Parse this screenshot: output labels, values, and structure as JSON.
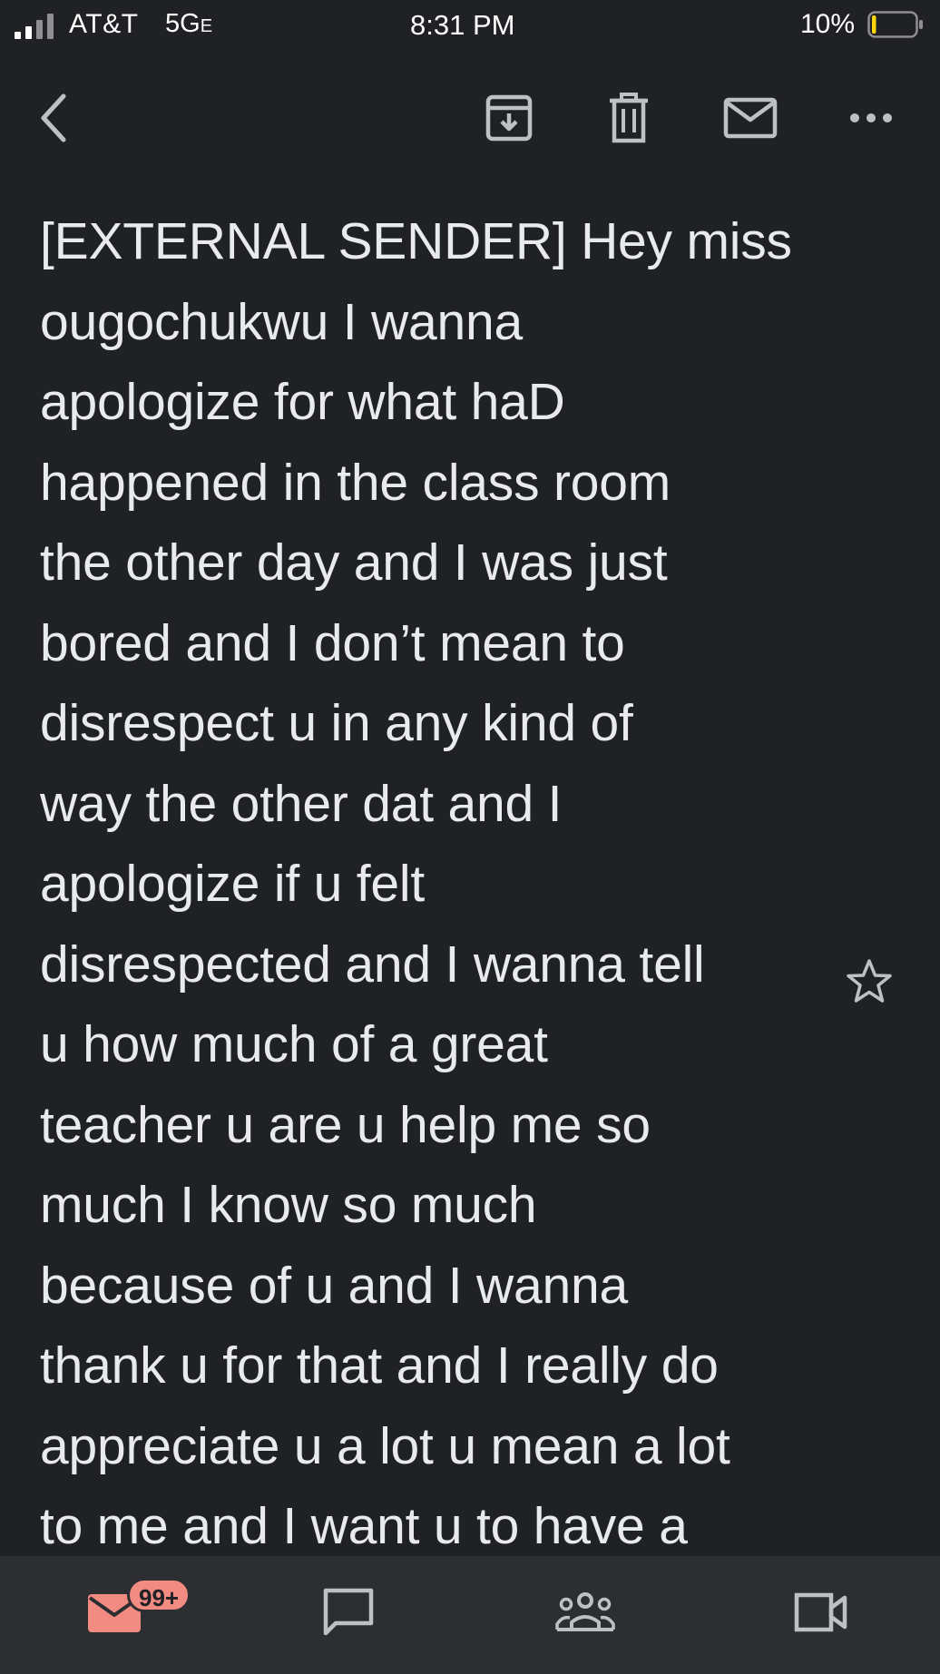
{
  "status_bar": {
    "carrier": "AT&T",
    "network": "5G",
    "network_suffix": "E",
    "time": "8:31 PM",
    "battery_percent": "10%",
    "battery_level": 0.1,
    "battery_color": "#ffd60a"
  },
  "toolbar": {
    "icons": [
      "back-icon",
      "archive-icon",
      "trash-icon",
      "mail-icon",
      "more-icon"
    ]
  },
  "email": {
    "body_lines": [
      "[EXTERNAL SENDER] Hey miss",
      "ougochukwu I wanna",
      "apologize for what haD",
      "happened in the class room",
      "the other day and I was just",
      "bored and I don’t mean to",
      "disrespect u in any kind of",
      "way the other dat and I",
      "apologize if u felt",
      "disrespected and I wanna tell",
      "u how much of a great",
      "teacher u are u help me so",
      "much I know so much",
      "because of u and I wanna",
      "thank u for that and I really do",
      "appreciate u a lot u mean a lot",
      "to me and I want u to have a"
    ]
  },
  "bottom_nav": {
    "mail_badge": "99+",
    "accent_color": "#f28b82",
    "items": [
      "mail-icon",
      "chat-icon",
      "spaces-icon",
      "meet-icon"
    ]
  }
}
